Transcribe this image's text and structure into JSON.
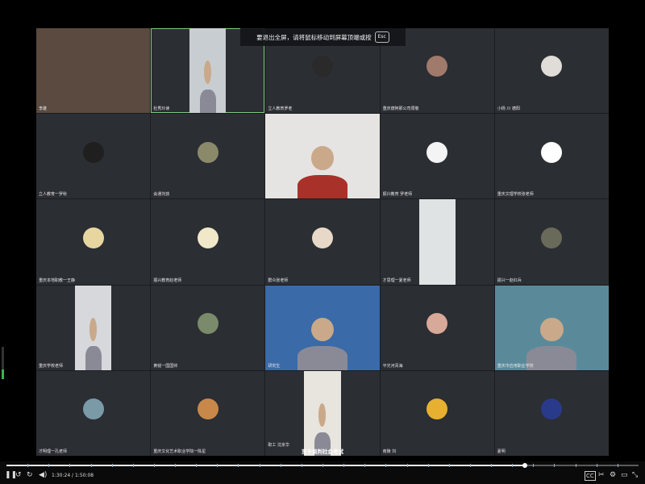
{
  "fullscreen_banner": {
    "text": "要退出全屏，请将鼠标移动到屏幕顶端或按",
    "key": "Esc"
  },
  "participants": [
    {
      "name": "李雄",
      "type": "video",
      "bg": "#5a4a40"
    },
    {
      "name": "杜秀玲读",
      "type": "video",
      "bg": "#c8cdd2",
      "speaking": true
    },
    {
      "name": "立人教育罗老",
      "type": "avatar",
      "avatar_color": "#2a2a2a"
    },
    {
      "name": "重庆德阿那公司周敬",
      "type": "avatar",
      "avatar_color": "#a07a6a"
    },
    {
      "name": "小杨 川 德阳",
      "type": "avatar",
      "avatar_color": "#e0ddd8"
    },
    {
      "name": "立人教育一罗秋",
      "type": "avatar",
      "avatar_color": "#1f1f1f"
    },
    {
      "name": "会通刘孩",
      "type": "avatar",
      "avatar_color": "#8a8a6a"
    },
    {
      "name": "立德教小林",
      "type": "video",
      "bg": "#e6e4e2"
    },
    {
      "name": "振兴教育 罗老师",
      "type": "avatar",
      "avatar_color": "#f4f4f4"
    },
    {
      "name": "重庆文理学校张老师",
      "type": "avatar",
      "avatar_color": "#ffffff"
    },
    {
      "name": "重庆本地职教一王静",
      "type": "avatar",
      "avatar_color": "#e7d6a0"
    },
    {
      "name": "振兴教育赵老师",
      "type": "avatar",
      "avatar_color": "#f0e8c8"
    },
    {
      "name": "群众张老师",
      "type": "avatar",
      "avatar_color": "#e8d8c8"
    },
    {
      "name": "才思理一夏老师",
      "type": "video",
      "bg": "#dfe3e4"
    },
    {
      "name": "振兴一赵红兵",
      "type": "avatar",
      "avatar_color": "#6a6a5a"
    },
    {
      "name": "重庆学校老师",
      "type": "video",
      "bg": "#d6d8dc"
    },
    {
      "name": "黄锐一国国帅",
      "type": "avatar",
      "avatar_color": "#7a8a6a"
    },
    {
      "name": "研究生",
      "type": "video",
      "bg": "#3a6aa8"
    },
    {
      "name": "平光河青海",
      "type": "avatar",
      "avatar_color": "#d8a898"
    },
    {
      "name": "重庆市应用职业学校",
      "type": "video",
      "bg": "#5a8a9a"
    },
    {
      "name": "才明理一孔老师",
      "type": "avatar",
      "avatar_color": "#7a9aa8"
    },
    {
      "name": "重庆文化艺术职业学院一陈星",
      "type": "avatar",
      "avatar_color": "#c8884a"
    },
    {
      "name": "至于谈判社会考试",
      "type": "video",
      "bg": "#e8e4de",
      "big_label": true,
      "sub_label": "职工 沈京华"
    },
    {
      "name": "南陵 刘",
      "type": "avatar",
      "avatar_color": "#e8b030"
    },
    {
      "name": "夏明",
      "type": "avatar",
      "avatar_color": "#2a3a8a"
    }
  ],
  "player": {
    "time_current": "1:30:24",
    "time_total": "1:50:08",
    "progress": 0.82,
    "icons": [
      "pause-icon",
      "rewind-icon",
      "skip-icon",
      "volume-icon",
      "cc-icon",
      "cut-icon",
      "settings-icon",
      "pip-icon",
      "fullscreen-exit-icon"
    ]
  }
}
